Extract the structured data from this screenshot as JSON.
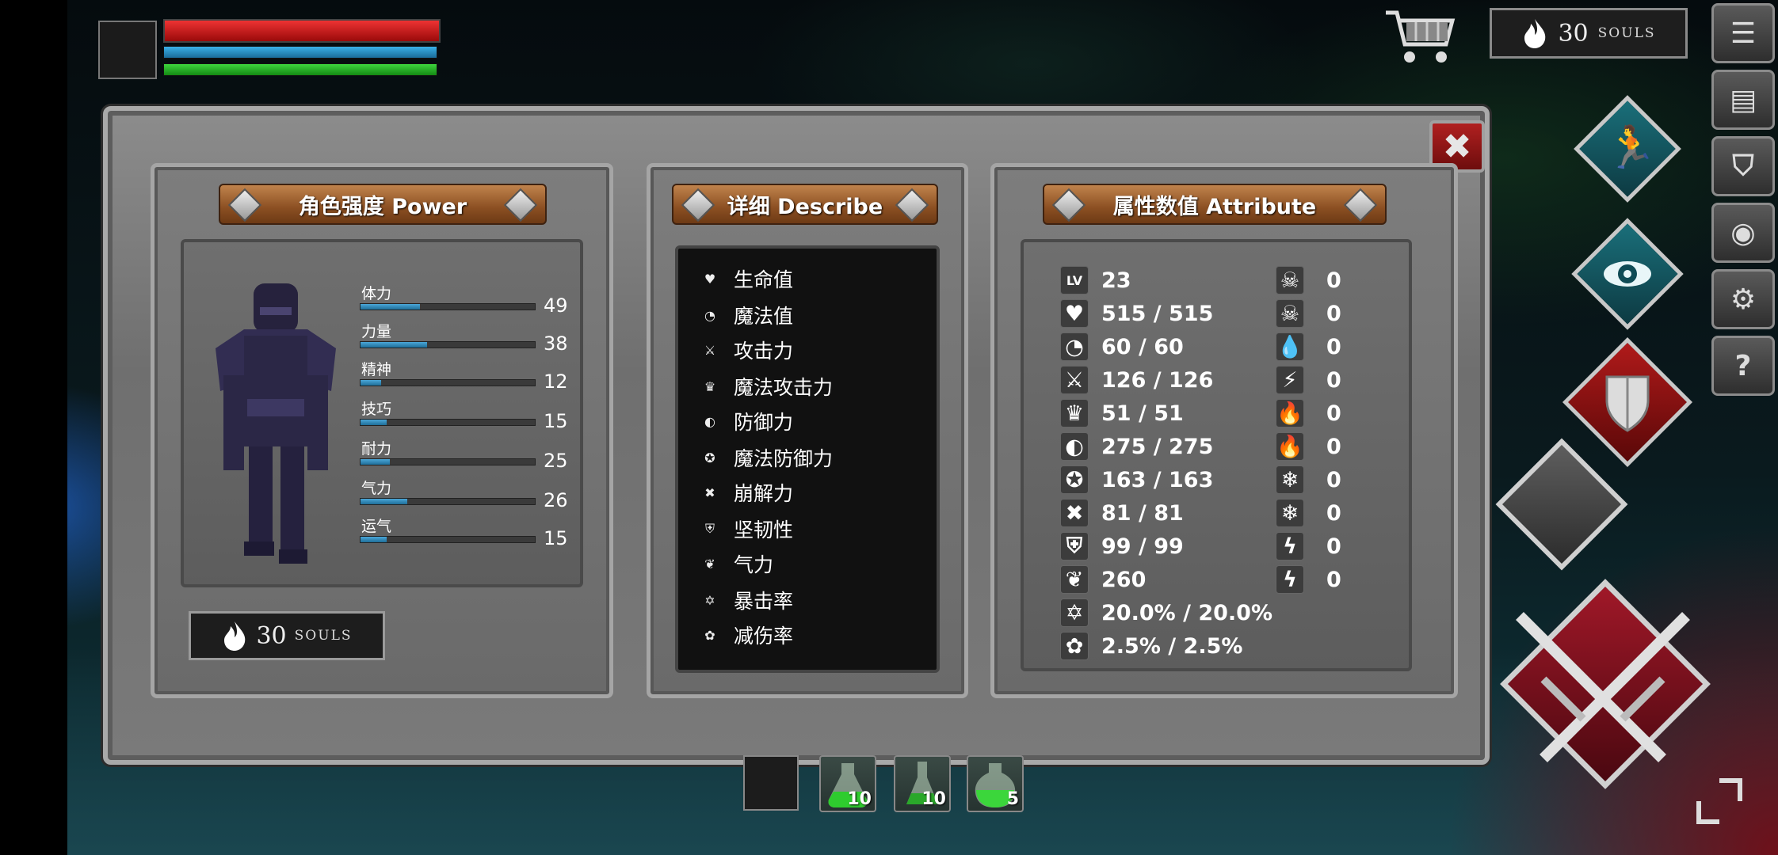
{
  "hud": {
    "souls_top": "30",
    "souls_word": "SOULS"
  },
  "sidebar_buttons": [
    {
      "name": "menu-list-button",
      "icon": "list-icon",
      "glyph": "☰"
    },
    {
      "name": "journal-button",
      "icon": "book-icon",
      "glyph": "▤"
    },
    {
      "name": "equipment-button",
      "icon": "helmet-icon",
      "glyph": "⛉"
    },
    {
      "name": "skills-button",
      "icon": "emblem-icon",
      "glyph": "◉"
    },
    {
      "name": "settings-button",
      "icon": "gear-icon",
      "glyph": "⚙"
    },
    {
      "name": "help-button",
      "icon": "help-icon",
      "glyph": "?"
    }
  ],
  "panels": {
    "power": {
      "title": "角色强度 Power"
    },
    "describe": {
      "title": "详细 Describe"
    },
    "attribute": {
      "title": "属性数值 Attribute"
    }
  },
  "stats": [
    {
      "label": "体力",
      "value": "49",
      "fill": 0.34
    },
    {
      "label": "力量",
      "value": "38",
      "fill": 0.38
    },
    {
      "label": "精神",
      "value": "12",
      "fill": 0.12
    },
    {
      "label": "技巧",
      "value": "15",
      "fill": 0.15
    },
    {
      "label": "耐力",
      "value": "25",
      "fill": 0.17
    },
    {
      "label": "气力",
      "value": "26",
      "fill": 0.27
    },
    {
      "label": "运气",
      "value": "15",
      "fill": 0.15
    }
  ],
  "power_souls": {
    "value": "30",
    "word": "SOULS"
  },
  "describe_rows": [
    {
      "label": "生命值",
      "icon": "heart-icon",
      "glyph": "♥"
    },
    {
      "label": "魔法值",
      "icon": "mana-head-icon",
      "glyph": "◔"
    },
    {
      "label": "攻击力",
      "icon": "sword-icon",
      "glyph": "⚔"
    },
    {
      "label": "魔法攻击力",
      "icon": "magic-crown-icon",
      "glyph": "♛"
    },
    {
      "label": "防御力",
      "icon": "shield-icon",
      "glyph": "◐"
    },
    {
      "label": "魔法防御力",
      "icon": "magic-shield-icon",
      "glyph": "✪"
    },
    {
      "label": "崩解力",
      "icon": "break-icon",
      "glyph": "✖"
    },
    {
      "label": "坚韧性",
      "icon": "helmet-icon",
      "glyph": "⛨"
    },
    {
      "label": "气力",
      "icon": "lungs-icon",
      "glyph": "❦"
    },
    {
      "label": "暴击率",
      "icon": "critical-icon",
      "glyph": "✡"
    },
    {
      "label": "减伤率",
      "icon": "reduction-icon",
      "glyph": "✿"
    }
  ],
  "attribute_left": [
    {
      "tag": "LV",
      "icon": "level-icon",
      "value": "23"
    },
    {
      "tag": "♥",
      "icon": "heart-icon",
      "value": "515 / 515"
    },
    {
      "tag": "◔",
      "icon": "mana-head-icon",
      "value": "60 / 60"
    },
    {
      "tag": "⚔",
      "icon": "sword-icon",
      "value": "126 / 126"
    },
    {
      "tag": "♛",
      "icon": "magic-crown-icon",
      "value": "51 / 51"
    },
    {
      "tag": "◐",
      "icon": "shield-icon",
      "value": "275 / 275"
    },
    {
      "tag": "✪",
      "icon": "magic-shield-icon",
      "value": "163 / 163"
    },
    {
      "tag": "✖",
      "icon": "break-icon",
      "value": "81 / 81"
    },
    {
      "tag": "⛨",
      "icon": "helmet-icon",
      "value": "99 / 99"
    },
    {
      "tag": "❦",
      "icon": "lungs-icon",
      "value": "260"
    },
    {
      "tag": "✡",
      "icon": "critical-icon",
      "value": "20.0% / 20.0%"
    },
    {
      "tag": "✿",
      "icon": "reduction-icon",
      "value": "2.5% / 2.5%"
    }
  ],
  "attribute_right": [
    {
      "tag": "☠",
      "icon": "poison-skull-icon",
      "value": "0"
    },
    {
      "tag": "☠",
      "icon": "poison-resist-icon",
      "value": "0"
    },
    {
      "tag": "💧",
      "icon": "bleed-icon",
      "value": "0"
    },
    {
      "tag": "⚡",
      "icon": "bleed-resist-icon",
      "value": "0"
    },
    {
      "tag": "🔥",
      "icon": "fire-icon",
      "value": "0"
    },
    {
      "tag": "🔥",
      "icon": "fire-resist-icon",
      "value": "0"
    },
    {
      "tag": "❄",
      "icon": "frost-icon",
      "value": "0"
    },
    {
      "tag": "❄",
      "icon": "frost-resist-icon",
      "value": "0"
    },
    {
      "tag": "ϟ",
      "icon": "lightning-icon",
      "value": "0"
    },
    {
      "tag": "ϟ",
      "icon": "lightning-resist-icon",
      "value": "0"
    }
  ],
  "quickbar": [
    {
      "name": "potion-slot-1",
      "count": "10",
      "color": "#2ecc2e"
    },
    {
      "name": "potion-slot-2",
      "count": "10",
      "color": "#2aa82a"
    },
    {
      "name": "potion-slot-3",
      "count": "5",
      "color": "#3bd63b"
    }
  ],
  "colors": {
    "hp": "#d42020",
    "mp": "#2f9fd8",
    "stamina": "#2cc42c",
    "plank": "#a0622e"
  }
}
